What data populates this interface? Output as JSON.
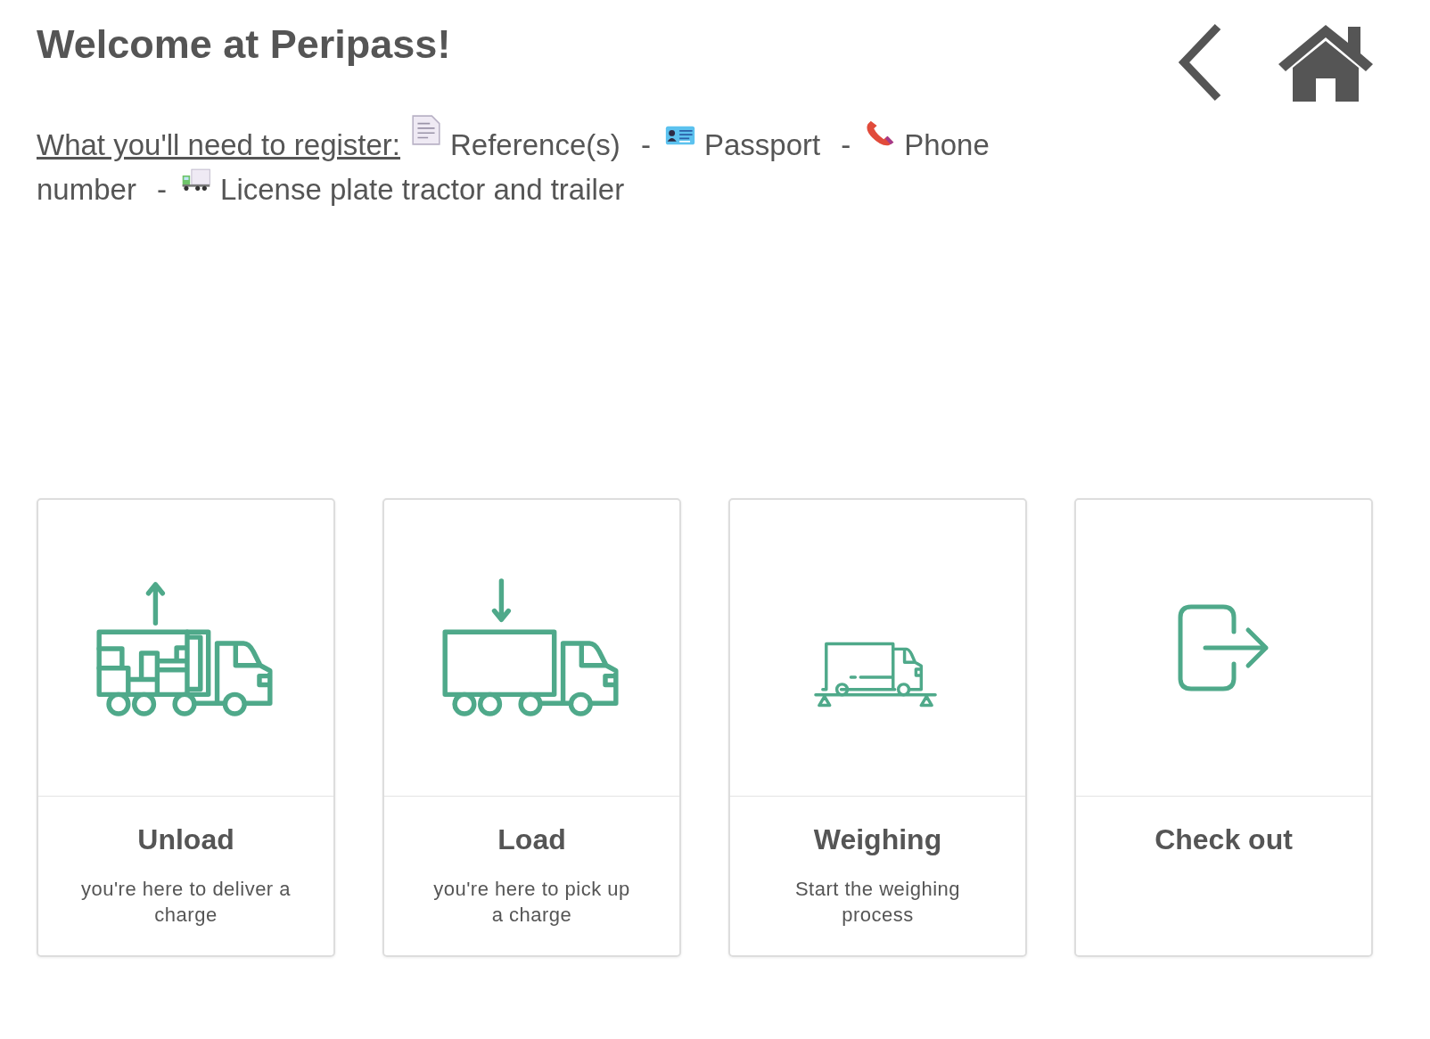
{
  "title": "Welcome at Peripass!",
  "requirements": {
    "label": "What you'll need to register:",
    "items": [
      {
        "kind": "document",
        "text": "Reference(s)"
      },
      {
        "kind": "separator",
        "text": "-"
      },
      {
        "kind": "id-card",
        "text": "Passport"
      },
      {
        "kind": "separator",
        "text": "-"
      },
      {
        "kind": "phone",
        "text": "Phone number"
      },
      {
        "kind": "separator",
        "text": "-"
      },
      {
        "kind": "truck",
        "text": "License plate tractor and trailer"
      }
    ]
  },
  "cards": [
    {
      "kind": "unload",
      "title": "Unload",
      "subtitle": "you're here to deliver a charge"
    },
    {
      "kind": "load",
      "title": "Load",
      "subtitle": "you're here to pick up a charge"
    },
    {
      "kind": "weighing",
      "title": "Weighing",
      "subtitle": "Start the weighing process"
    },
    {
      "kind": "checkout",
      "title": "Check out"
    }
  ]
}
